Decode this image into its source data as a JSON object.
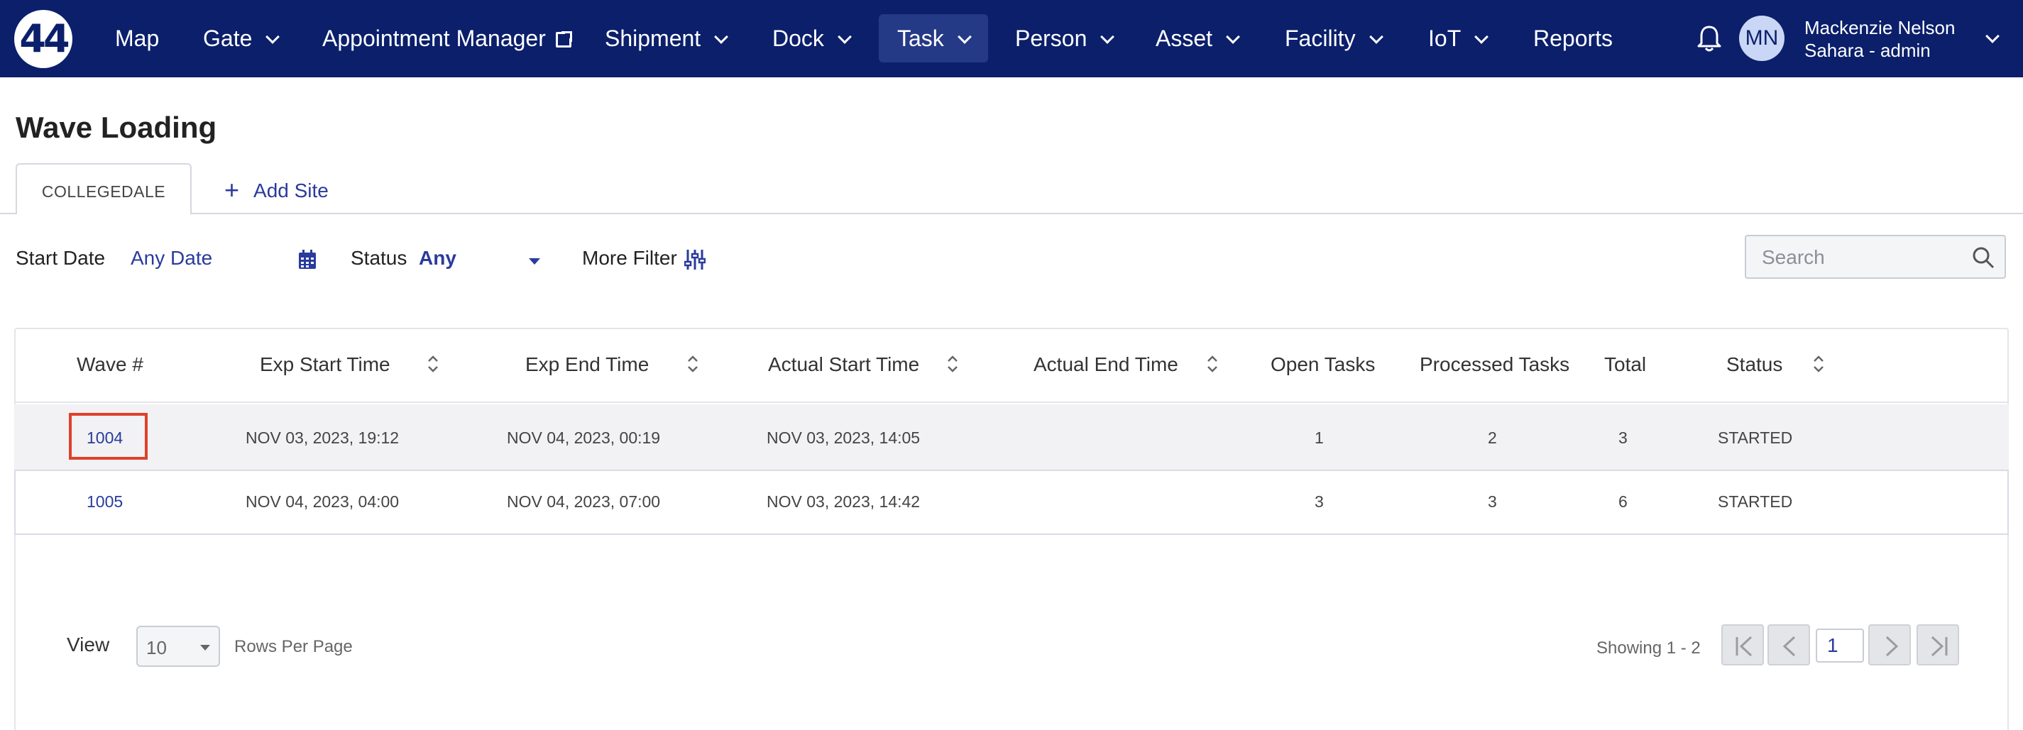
{
  "nav": {
    "logo_text": "44",
    "items": [
      {
        "label": "Map"
      },
      {
        "label": "Gate"
      },
      {
        "label": "Appointment Manager"
      },
      {
        "label": "Shipment"
      },
      {
        "label": "Dock"
      },
      {
        "label": "Task"
      },
      {
        "label": "Person"
      },
      {
        "label": "Asset"
      },
      {
        "label": "Facility"
      },
      {
        "label": "IoT"
      },
      {
        "label": "Reports"
      }
    ],
    "active": "Task"
  },
  "user": {
    "initials": "MN",
    "name": "Mackenzie Nelson",
    "role": "Sahara - admin"
  },
  "page": {
    "title": "Wave Loading"
  },
  "tabs": {
    "active_label": "COLLEGEDALE",
    "add_label": "Add Site"
  },
  "filters": {
    "start_date_label": "Start Date",
    "start_date_value": "Any Date",
    "status_label": "Status",
    "status_value": "Any",
    "more_filter_label": "More Filter",
    "search_placeholder": "Search"
  },
  "table": {
    "columns": [
      "Wave #",
      "Exp Start Time",
      "Exp End Time",
      "Actual Start Time",
      "Actual End Time",
      "Open Tasks",
      "Processed Tasks",
      "Total",
      "Status"
    ],
    "rows": [
      {
        "wave": "1004",
        "exp_start": "NOV 03, 2023, 19:12",
        "exp_end": "NOV 04, 2023, 00:19",
        "actual_start": "NOV 03, 2023, 14:05",
        "actual_end": "",
        "open": "1",
        "processed": "2",
        "total": "3",
        "status": "STARTED"
      },
      {
        "wave": "1005",
        "exp_start": "NOV 04, 2023, 04:00",
        "exp_end": "NOV 04, 2023, 07:00",
        "actual_start": "NOV 03, 2023, 14:42",
        "actual_end": "",
        "open": "3",
        "processed": "3",
        "total": "6",
        "status": "STARTED"
      }
    ]
  },
  "pagination": {
    "view_label": "View",
    "rows_per_page_value": "10",
    "rows_per_page_label": "Rows Per Page",
    "showing": "Showing 1 - 2",
    "current_page": "1"
  },
  "colors": {
    "nav_bg": "#0b1f6b",
    "accent": "#2a3b9c",
    "highlight": "#e0402a"
  }
}
